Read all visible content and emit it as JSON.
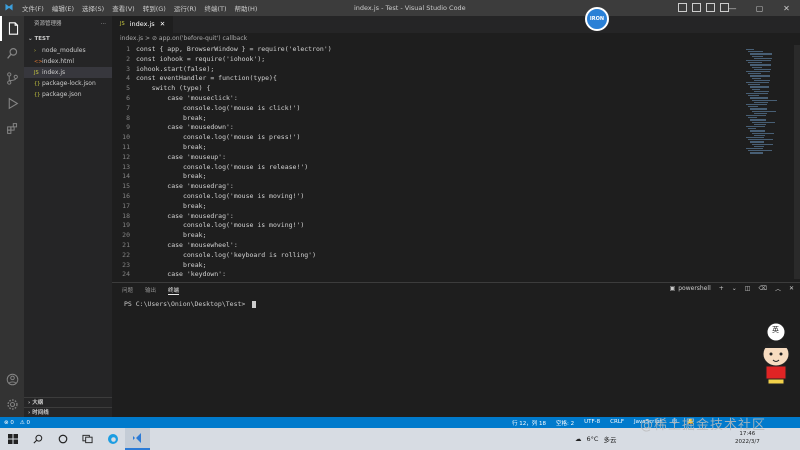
{
  "titlebar": {
    "menu": [
      "文件(F)",
      "编辑(E)",
      "选择(S)",
      "查看(V)",
      "转到(G)",
      "运行(R)",
      "终端(T)",
      "帮助(H)"
    ],
    "title": "index.js - Test - Visual Studio Code",
    "avatar_text": "IRON"
  },
  "sidebar": {
    "header": "资源管理器",
    "folder": "TEST",
    "files": [
      {
        "name": "node_modules",
        "icon": "›"
      },
      {
        "name": "index.html",
        "icon": "<>"
      },
      {
        "name": "index.js",
        "icon": "JS"
      },
      {
        "name": "package-lock.json",
        "icon": "{}"
      },
      {
        "name": "package.json",
        "icon": "{}"
      }
    ],
    "outline": "大纲",
    "timeline": "时间线"
  },
  "tab": {
    "label": "index.js",
    "icon": "JS"
  },
  "breadcrumb": "index.js > ⊘ app.on('before-quit') callback",
  "code": [
    {
      "n": "1",
      "t": "const { app, BrowserWindow } = require('electron')"
    },
    {
      "n": "2",
      "t": "const iohook = require('iohook');"
    },
    {
      "n": "3",
      "t": "iohook.start(false);"
    },
    {
      "n": "4",
      "t": "const eventHandler = function(type){"
    },
    {
      "n": "5",
      "t": "    switch (type) {"
    },
    {
      "n": "6",
      "t": "        case 'mouseclick':"
    },
    {
      "n": "7",
      "t": "            console.log('mouse is click!')"
    },
    {
      "n": "8",
      "t": "            break;"
    },
    {
      "n": "9",
      "t": "        case 'mousedown':"
    },
    {
      "n": "10",
      "t": "            console.log('mouse is press!')"
    },
    {
      "n": "11",
      "t": "            break;"
    },
    {
      "n": "12",
      "t": "        case 'mouseup':"
    },
    {
      "n": "13",
      "t": "            console.log('mouse is release!')"
    },
    {
      "n": "14",
      "t": "            break;"
    },
    {
      "n": "15",
      "t": "        case 'mousedrag':"
    },
    {
      "n": "16",
      "t": "            console.log('mouse is moving!')"
    },
    {
      "n": "17",
      "t": "            break;"
    },
    {
      "n": "18",
      "t": "        case 'mousedrag':"
    },
    {
      "n": "19",
      "t": "            console.log('mouse is moving!')"
    },
    {
      "n": "20",
      "t": "            break;"
    },
    {
      "n": "21",
      "t": "        case 'mousewheel':"
    },
    {
      "n": "22",
      "t": "            console.log('keyboard is rolling')"
    },
    {
      "n": "23",
      "t": "            break;"
    },
    {
      "n": "24",
      "t": "        case 'keydown':"
    }
  ],
  "panel": {
    "tabs": [
      "问题",
      "输出",
      "终端"
    ],
    "active_tab": "终端",
    "terminal_type": "powershell",
    "prompt": "PS C:\\Users\\Onion\\Desktop\\Test> "
  },
  "status": {
    "errors": "⊗ 0",
    "warnings": "⚠ 0",
    "position": "行 12，列 18",
    "spaces": "空格: 2",
    "encoding": "UTF-8",
    "eol": "CRLF",
    "language": "JavaScript"
  },
  "taskbar": {
    "weather_temp": "6°C",
    "weather_desc": "多云",
    "time": "17:46",
    "date": "2022/3/7"
  },
  "sticker_text": "英",
  "watermark": "@稀土掘金技术社区",
  "colors": {
    "activity_bar": "#333333",
    "sidebar": "#252526",
    "editor": "#1e1e1e",
    "statusbar": "#007acc",
    "taskbar": "#d7dce3"
  }
}
